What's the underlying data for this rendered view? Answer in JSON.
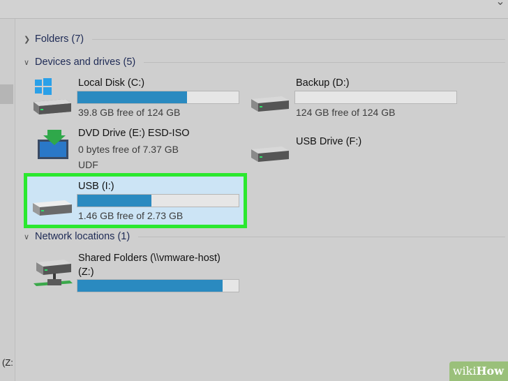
{
  "groups": {
    "folders": {
      "label": "Folders (7)",
      "expanded": false
    },
    "devices": {
      "label": "Devices and drives (5)",
      "expanded": true
    },
    "network": {
      "label": "Network locations (1)",
      "expanded": true
    }
  },
  "drives": [
    {
      "name": "Local Disk (C:)",
      "detail": "39.8 GB free of 124 GB",
      "used_fraction": 0.68,
      "icon": "windows-drive-icon"
    },
    {
      "name": "Backup (D:)",
      "detail": "124 GB free of 124 GB",
      "used_fraction": 0.0,
      "icon": "hard-drive-icon"
    },
    {
      "name": "DVD Drive (E:) ESD-ISO",
      "detail": "0 bytes free of 7.37 GB",
      "detail2": "UDF",
      "icon": "dvd-drive-icon"
    },
    {
      "name": "USB Drive (F:)",
      "icon": "usb-drive-icon"
    },
    {
      "name": "USB (I:)",
      "detail": "1.46 GB free of 2.73 GB",
      "used_fraction": 0.46,
      "icon": "usb-drive-icon",
      "selected": true
    }
  ],
  "network_locations": [
    {
      "name_line1": "Shared Folders (\\\\vmware-host)",
      "name_line2": "(Z:)",
      "used_fraction": 0.9,
      "icon": "network-drive-icon"
    }
  ],
  "left_pane_label": "(Z:",
  "watermark": {
    "prefix": "wiki",
    "suffix": "How"
  },
  "colors": {
    "bar_fill": "#2a8ac0",
    "selection_border": "#2be82f",
    "selection_bg": "#cce4f5"
  }
}
